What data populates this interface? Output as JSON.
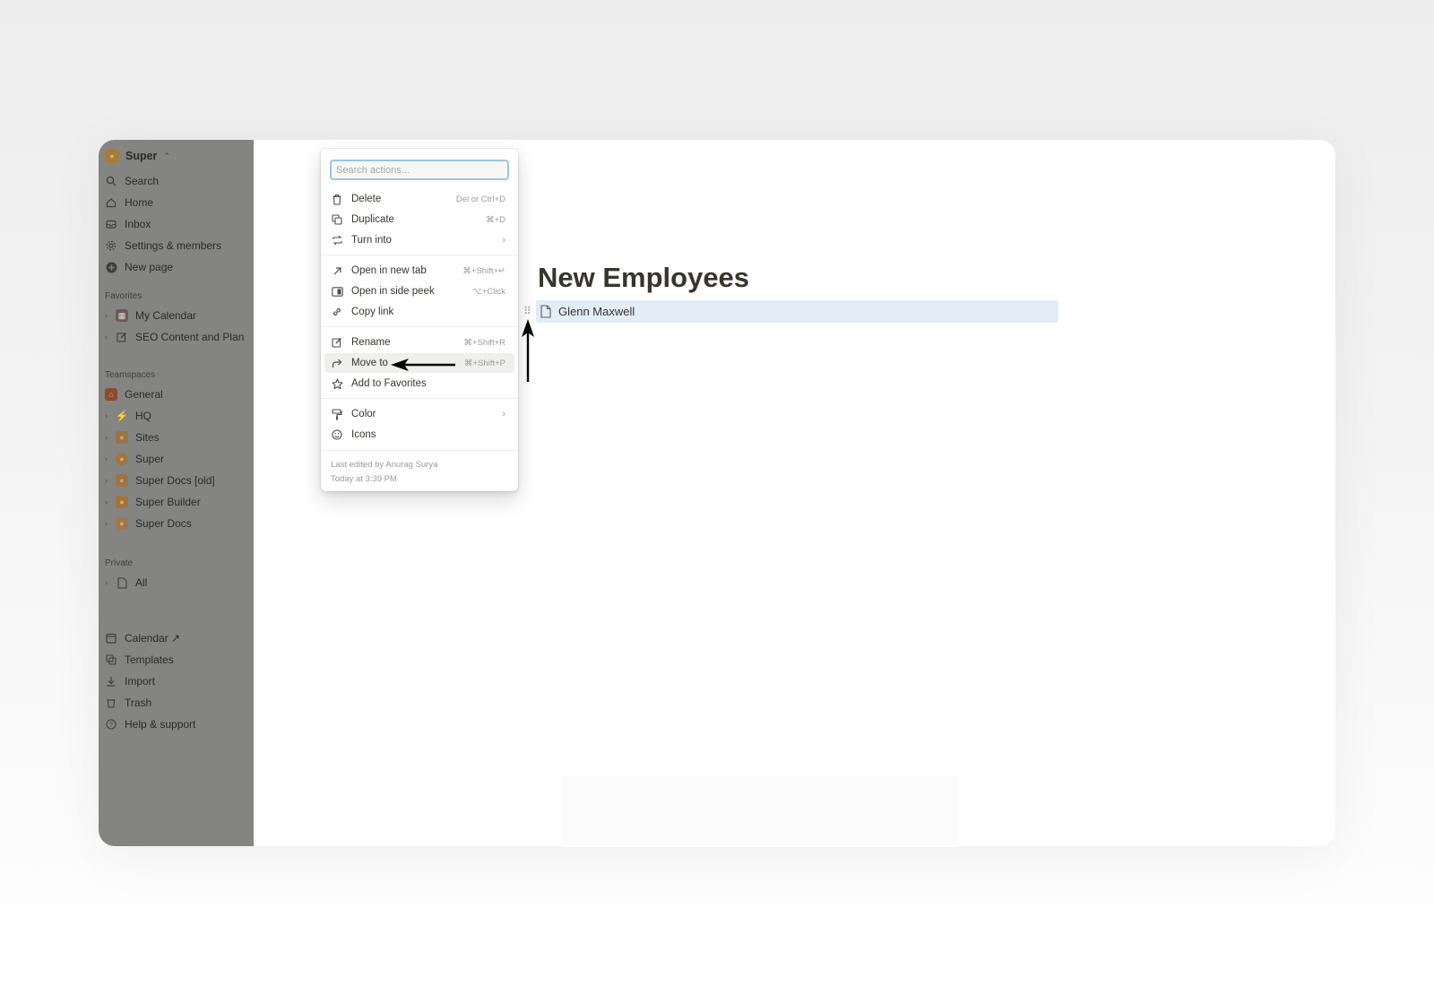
{
  "sidebar": {
    "workspace_name": "Super",
    "nav": [
      {
        "label": "Search",
        "icon": "search-icon"
      },
      {
        "label": "Home",
        "icon": "home-icon"
      },
      {
        "label": "Inbox",
        "icon": "inbox-icon"
      },
      {
        "label": "Settings & members",
        "icon": "gear-icon"
      },
      {
        "label": "New page",
        "icon": "plus-circle-icon"
      }
    ],
    "favorites_label": "Favorites",
    "favorites": [
      {
        "label": "My Calendar",
        "icon": "calendar-icon"
      },
      {
        "label": "SEO Content and Plan",
        "icon": "edit-icon"
      }
    ],
    "teamspaces_label": "Teamspaces",
    "teamspaces": [
      {
        "label": "General",
        "icon": "home-icon"
      },
      {
        "label": "HQ",
        "icon": "bolt-icon"
      },
      {
        "label": "Sites",
        "icon": "teamspace-icon"
      },
      {
        "label": "Super",
        "icon": "teamspace-icon"
      },
      {
        "label": "Super Docs [old]",
        "icon": "teamspace-icon"
      },
      {
        "label": "Super Builder",
        "icon": "teamspace-icon"
      },
      {
        "label": "Super Docs",
        "icon": "teamspace-icon"
      }
    ],
    "private_label": "Private",
    "private": [
      {
        "label": "All",
        "icon": "page-icon"
      }
    ],
    "bottom": [
      {
        "label": "Calendar ↗",
        "icon": "calendar-icon"
      },
      {
        "label": "Templates",
        "icon": "templates-icon"
      },
      {
        "label": "Import",
        "icon": "download-icon"
      },
      {
        "label": "Trash",
        "icon": "trash-icon"
      },
      {
        "label": "Help & support",
        "icon": "help-icon"
      }
    ]
  },
  "page": {
    "title": "New Employees",
    "rows": [
      {
        "label": "Glenn Maxwell"
      }
    ]
  },
  "menu": {
    "search_placeholder": "Search actions...",
    "items": [
      {
        "label": "Delete",
        "shortcut": "Del or Ctrl+D",
        "icon": "trash-icon"
      },
      {
        "label": "Duplicate",
        "shortcut": "⌘+D",
        "icon": "duplicate-icon"
      },
      {
        "label": "Turn into",
        "shortcut": "›",
        "icon": "turn-into-icon"
      },
      {
        "label": "Open in new tab",
        "shortcut": "⌘+Shift+↵",
        "icon": "open-new-tab-icon"
      },
      {
        "label": "Open in side peek",
        "shortcut": "⌥+Click",
        "icon": "side-peek-icon"
      },
      {
        "label": "Copy link",
        "shortcut": "",
        "icon": "link-icon"
      },
      {
        "label": "Rename",
        "shortcut": "⌘+Shift+R",
        "icon": "rename-icon"
      },
      {
        "label": "Move to",
        "shortcut": "⌘+Shift+P",
        "icon": "move-to-icon"
      },
      {
        "label": "Add to Favorites",
        "shortcut": "",
        "icon": "star-icon"
      },
      {
        "label": "Color",
        "shortcut": "›",
        "icon": "paint-icon"
      },
      {
        "label": "Icons",
        "shortcut": "",
        "icon": "smiley-icon"
      }
    ],
    "footer_line1": "Last edited by Anurag Surya",
    "footer_line2": "Today at 3:39 PM"
  },
  "colors": {
    "sidebar_bg": "#848483",
    "row_highlight": "#e3edf8",
    "search_focus_border": "#9cc3e6",
    "menu_hover": "#efefee"
  }
}
